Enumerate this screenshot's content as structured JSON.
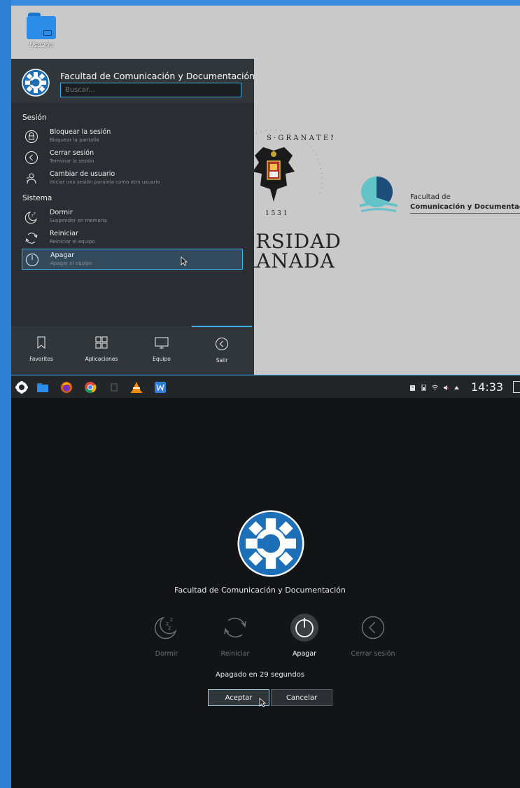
{
  "desktop": {
    "folder_label": "Usuario",
    "wallpaper": {
      "seal_top": "S · G R A N A T E N S",
      "seal_bottom": "1 5 3 1",
      "univ_line1": "ERSIDAD",
      "univ_line2": "RANADA",
      "faculty_small": "Facultad de",
      "faculty_big": "Comunicación y Documentació"
    }
  },
  "launcher": {
    "title": "Facultad de Comunicación y Documentación",
    "search_placeholder": "Buscar...",
    "sections": [
      {
        "title": "Sesión",
        "items": [
          {
            "label": "Bloquear la sesión",
            "sub": "Bloquear la pantalla",
            "icon": "lock-icon"
          },
          {
            "label": "Cerrar sesión",
            "sub": "Terminar la sesión",
            "icon": "logout-icon"
          },
          {
            "label": "Cambiar de usuario",
            "sub": "Iniciar una sesión paralela como otro usuario",
            "icon": "switch-user-icon"
          }
        ]
      },
      {
        "title": "Sistema",
        "items": [
          {
            "label": "Dormir",
            "sub": "Suspender en memoria",
            "icon": "sleep-icon"
          },
          {
            "label": "Reiniciar",
            "sub": "Reiniciar el equipo",
            "icon": "restart-icon"
          },
          {
            "label": "Apagar",
            "sub": "Apagar el equipo",
            "icon": "power-icon",
            "selected": true
          }
        ]
      }
    ],
    "tabs": [
      {
        "label": "Favoritos",
        "icon": "bookmark-icon"
      },
      {
        "label": "Aplicaciones",
        "icon": "grid-icon"
      },
      {
        "label": "Equipo",
        "icon": "monitor-icon"
      },
      {
        "label": "Salir",
        "icon": "leave-icon",
        "active": true
      }
    ]
  },
  "taskbar": {
    "clock": "14:33",
    "apps": [
      "kde-launcher-icon",
      "file-manager-icon",
      "firefox-icon",
      "chrome-icon",
      "document-icon",
      "vlc-icon",
      "word-icon"
    ]
  },
  "logout_dialog": {
    "title": "Facultad de Comunicación y Documentación",
    "actions": [
      {
        "label": "Dormir",
        "icon": "sleep-icon"
      },
      {
        "label": "Reiniciar",
        "icon": "restart-icon"
      },
      {
        "label": "Apagar",
        "icon": "power-icon",
        "selected": true
      },
      {
        "label": "Cerrar sesión",
        "icon": "logout-icon"
      }
    ],
    "countdown": "Apagado en 29 segundos",
    "accept_label": "Aceptar",
    "cancel_label": "Cancelar"
  },
  "colors": {
    "accent": "#3daee9",
    "kde_blue": "#1d70b8",
    "launcher_bg": "#2a2e32",
    "wallpaper": "#c9c9c9"
  }
}
